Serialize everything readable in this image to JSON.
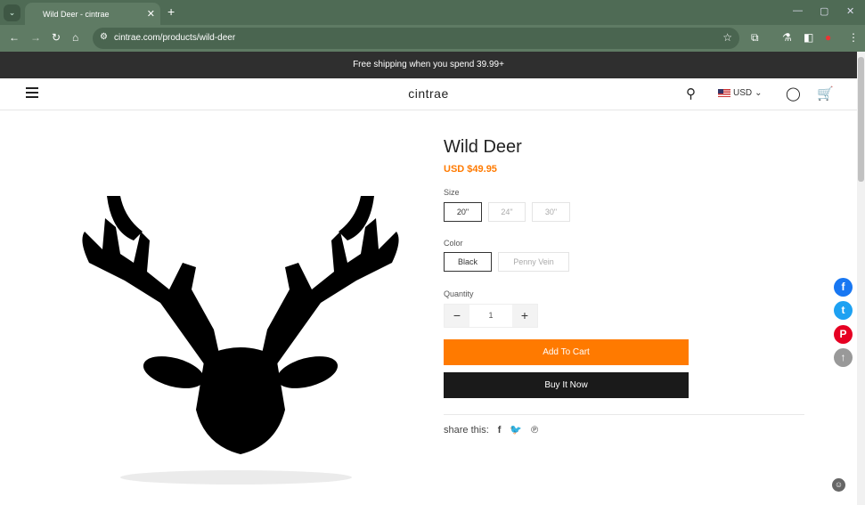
{
  "browser": {
    "tab_title": "Wild Deer - cintrae",
    "url": "cintrae.com/products/wild-deer"
  },
  "banner": "Free shipping when you spend 39.99+",
  "header": {
    "logo": "cintrae",
    "currency": "USD"
  },
  "product": {
    "title": "Wild Deer",
    "price": "USD $49.95",
    "size_label": "Size",
    "sizes": [
      "20\"",
      "24\"",
      "30\""
    ],
    "selected_size": "20\"",
    "color_label": "Color",
    "colors": [
      "Black",
      "Penny Vein"
    ],
    "selected_color": "Black",
    "quantity_label": "Quantity",
    "quantity": "1",
    "add_to_cart": "Add To Cart",
    "buy_now": "Buy It Now",
    "share_label": "share this:"
  },
  "colors": {
    "accent": "#ff7a00",
    "buy": "#1a1a1a",
    "facebook": "#1877f2",
    "twitter": "#1da1f2",
    "pinterest": "#e60023"
  }
}
